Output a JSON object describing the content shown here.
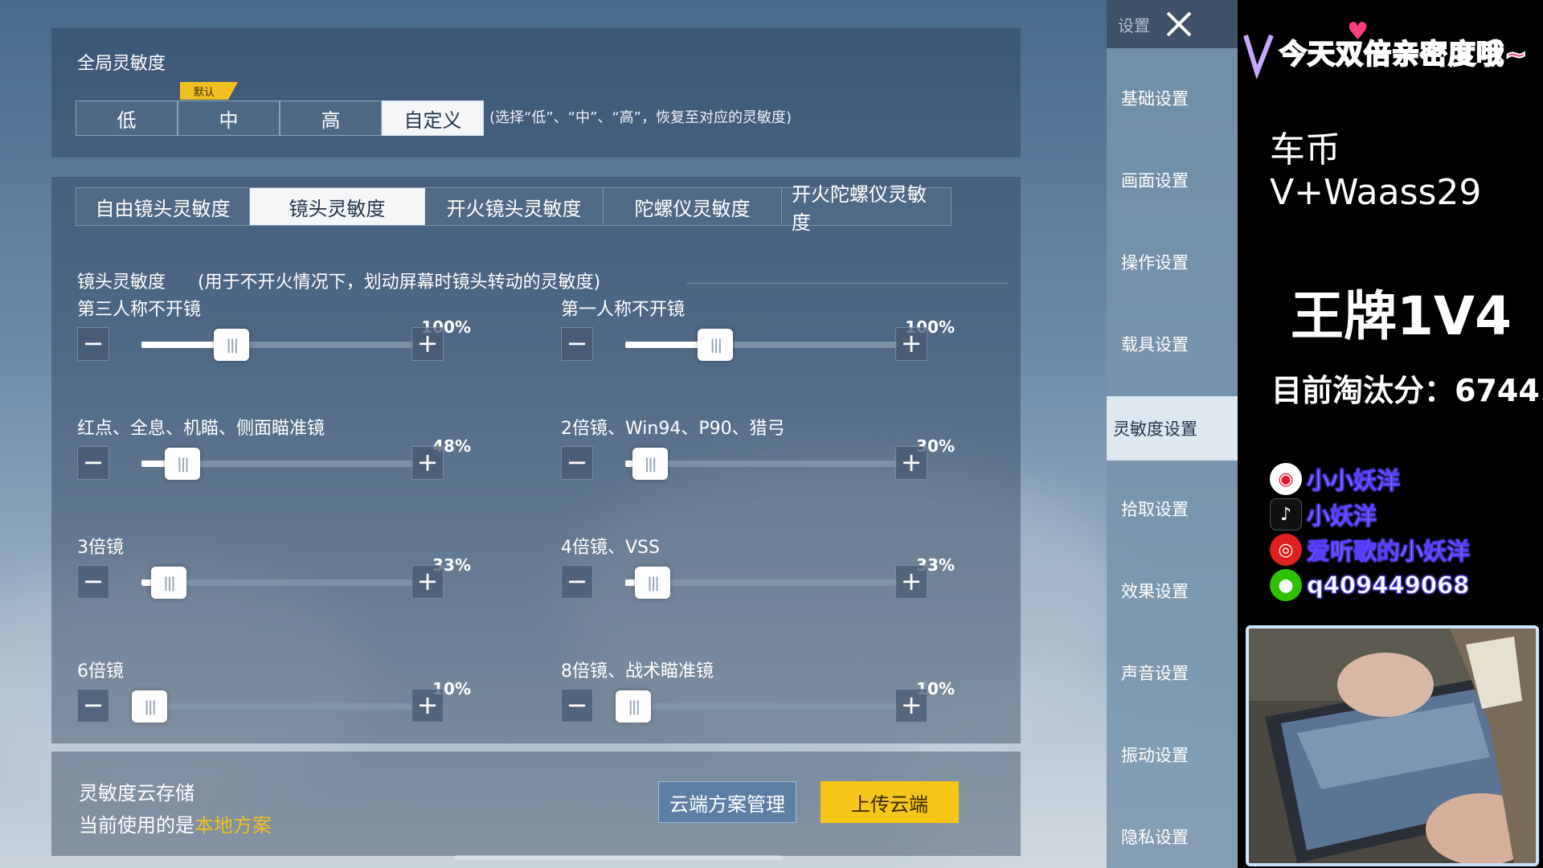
{
  "global_sensitivity": {
    "title": "全局灵敏度",
    "levels": [
      "低",
      "中",
      "高",
      "自定义"
    ],
    "default_tag": "默认",
    "hint": "(选择“低”、“中”、“高”，恢复至对应的灵敏度)",
    "selected": "自定义"
  },
  "sens_tabs": [
    "自由镜头灵敏度",
    "镜头灵敏度",
    "开火镜头灵敏度",
    "陀螺仪灵敏度",
    "开火陀螺仪灵敏度"
  ],
  "active_tab": "镜头灵敏度",
  "section": {
    "title": "镜头灵敏度",
    "desc": "(用于不开火情况下，划动屏幕时镜头转动的灵敏度)"
  },
  "sliders": [
    {
      "label": "第三人称不开镜",
      "pct": "100%",
      "value": 0.33
    },
    {
      "label": "第一人称不开镜",
      "pct": "100%",
      "value": 0.33
    },
    {
      "label": "红点、全息、机瞄、侧面瞄准镜",
      "pct": "48%",
      "value": 0.15
    },
    {
      "label": "2倍镜、Win94、P90、猎弓",
      "pct": "30%",
      "value": 0.09
    },
    {
      "label": "3倍镜",
      "pct": "33%",
      "value": 0.1
    },
    {
      "label": "4倍镜、VSS",
      "pct": "33%",
      "value": 0.1
    },
    {
      "label": "6倍镜",
      "pct": "10%",
      "value": 0.03
    },
    {
      "label": "8倍镜、战术瞄准镜",
      "pct": "10%",
      "value": 0.03
    }
  ],
  "cloud": {
    "title": "灵敏度云存储",
    "current_prefix": "当前使用的是",
    "current_plan": "本地方案",
    "manage_label": "云端方案管理",
    "upload_label": "上传云端"
  },
  "side_nav": {
    "top_label": "设置",
    "items": [
      "基础设置",
      "画面设置",
      "操作设置",
      "载具设置",
      "灵敏度设置",
      "拾取设置",
      "效果设置",
      "声音设置",
      "振动设置",
      "隐私设置"
    ],
    "active": "灵敏度设置"
  },
  "stream_overlay": {
    "banner": "今天双倍亲密度哦~",
    "line1": "车币V+Waass29",
    "line2": "王牌1V4",
    "line3": "目前淘汰分：6744",
    "socials": [
      {
        "icon": "weibo-icon",
        "text": "小小妖洋",
        "color": "#e6162d"
      },
      {
        "icon": "douyin-icon",
        "text": "小妖洋",
        "color": "#111111"
      },
      {
        "icon": "netease-music-icon",
        "text": "爱听歌的小妖洋",
        "color": "#e02020"
      },
      {
        "icon": "wechat-icon",
        "text": "q409449068",
        "color": "#2dc100"
      }
    ]
  },
  "colors": {
    "accent_yellow": "#f5c518",
    "plan_highlight": "#f0c020",
    "active_tab_bg": "#f4f6f8"
  }
}
